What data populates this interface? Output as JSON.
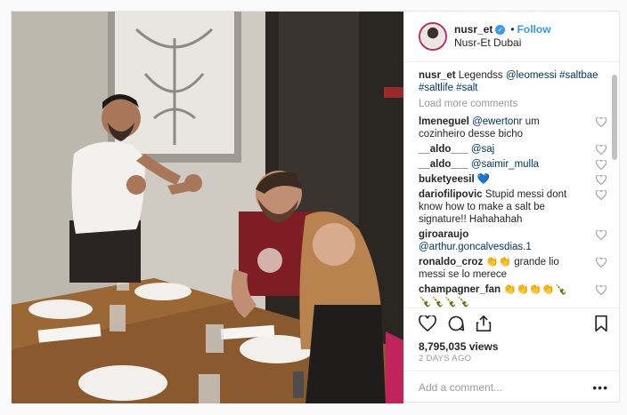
{
  "post": {
    "username": "nusr_et",
    "follow_label": "Follow",
    "location": "Nusr-Et Dubai",
    "caption": {
      "user": "nusr_et",
      "text": "Legendss",
      "mention": "@leomessi",
      "tags": "#saltbae #saltlife #salt"
    },
    "load_more": "Load more comments",
    "comments": [
      {
        "user": "lmeneguel",
        "mention": "@ewertonr",
        "text": " um cozinheiro desse bicho"
      },
      {
        "user": "__aldo___",
        "mention": "@saj",
        "text": ""
      },
      {
        "user": "__aldo___",
        "mention": "@saimir_mulla",
        "text": ""
      },
      {
        "user": "buketyeesil",
        "mention": "",
        "text": " 💙"
      },
      {
        "user": "dariofilipovic",
        "mention": "",
        "text": " Stupid messi dont know how to make a salt be signature!! Hahahahah"
      },
      {
        "user": "giroaraujo",
        "mention": "@arthur.goncalvesdias.1",
        "text": ""
      },
      {
        "user": "ronaldo_croz",
        "mention": "",
        "text": " 👏👏 grande lio messi se lo merece"
      },
      {
        "user": "champagner_fan",
        "mention": "",
        "text": " 👏👏👏👏🍾🍾🍾🍾🍾"
      }
    ],
    "views": "8,795,035 views",
    "time_ago": "2 DAYS AGO",
    "add_comment_placeholder": "Add a comment..."
  },
  "icons": [
    "heart-icon",
    "comment-icon",
    "share-icon",
    "bookmark-icon",
    "more-options-icon",
    "verified-badge-icon"
  ],
  "colors": {
    "accent": "#3897f0",
    "link": "#003569",
    "muted": "#999999"
  }
}
